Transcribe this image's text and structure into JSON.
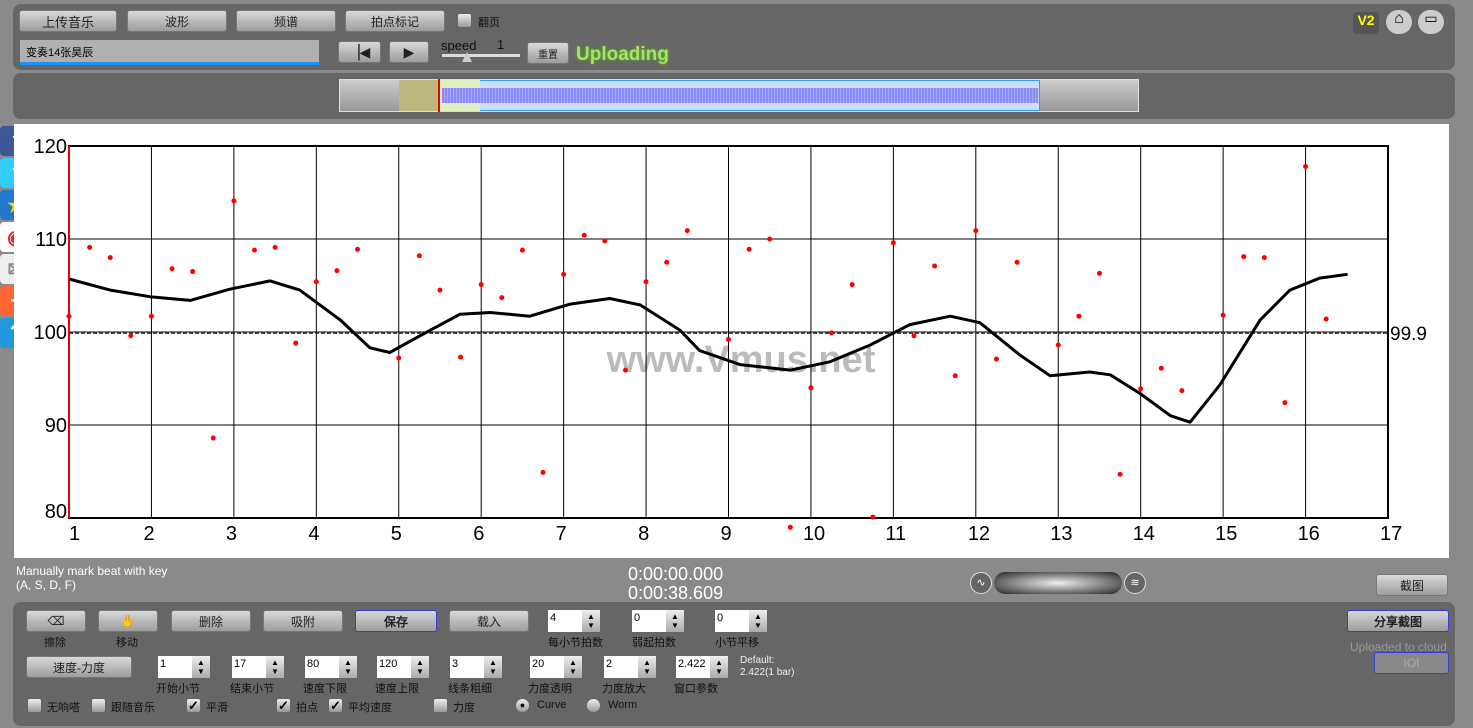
{
  "toolbar": {
    "upload": "上传音乐",
    "waveform": "波形",
    "spectrum": "频谱",
    "beat_mark": "拍点标记",
    "page_turn": "翻页",
    "filename": "变奏14张昊辰",
    "speed_label": "speed",
    "speed_value": "1",
    "reset": "重置",
    "status": "Uploading",
    "icons": [
      "skip-back-icon",
      "play-icon",
      "v2-icon",
      "home-icon",
      "screen-icon"
    ]
  },
  "share": [
    "facebook-icon",
    "twitter-icon",
    "star-icon",
    "weibo-icon",
    "mail-icon",
    "plus-icon",
    "help-icon"
  ],
  "watermark": "www.Vmus.net",
  "hint": {
    "line1": "Manually mark beat with key",
    "line2": "(A, S, D, F)"
  },
  "time": {
    "current": "0:00:00.000",
    "total": "0:00:38.609"
  },
  "screenshot": "截图",
  "controls": {
    "erase": "擦除",
    "move": "移动",
    "delete": "删除",
    "snap": "吸附",
    "save": "保存",
    "load": "载入",
    "tempo_dynamics": "速度-力度",
    "share_shot": "分享截图",
    "uploaded": "Uploaded to cloud",
    "ioi": "IOI",
    "default1": "Default:",
    "default2": "2.422(1 bar)",
    "spinners": [
      {
        "label": "每小节拍数",
        "value": "4"
      },
      {
        "label": "弱起拍数",
        "value": "0"
      },
      {
        "label": "小节平移",
        "value": "0"
      },
      {
        "label": "开始小节",
        "value": "1"
      },
      {
        "label": "结束小节",
        "value": "17"
      },
      {
        "label": "速度下限",
        "value": "80"
      },
      {
        "label": "速度上限",
        "value": "120"
      },
      {
        "label": "线条粗细",
        "value": "3"
      },
      {
        "label": "力度透明",
        "value": "20"
      },
      {
        "label": "力度放大",
        "value": "2"
      },
      {
        "label": "窗口参数",
        "value": "2.422"
      }
    ],
    "checks": [
      {
        "label": "无响嗒",
        "checked": false
      },
      {
        "label": "跟随音乐",
        "checked": false
      },
      {
        "label": "平滑",
        "checked": true
      },
      {
        "label": "拍点",
        "checked": true
      },
      {
        "label": "平均速度",
        "checked": true
      },
      {
        "label": "力度",
        "checked": false
      }
    ],
    "radios": [
      {
        "label": "Curve",
        "checked": true
      },
      {
        "label": "Worm",
        "checked": false
      }
    ]
  },
  "chart_data": {
    "type": "scatter",
    "xlim": [
      1,
      17
    ],
    "ylim": [
      80,
      120
    ],
    "xticks": [
      "1",
      "2",
      "3",
      "4",
      "5",
      "6",
      "7",
      "8",
      "9",
      "10",
      "11",
      "12",
      "13",
      "14",
      "15",
      "16",
      "17"
    ],
    "yticks": [
      "80",
      "90",
      "100",
      "110",
      "120"
    ],
    "grid": true,
    "average": 99.9,
    "average_label": "99.9",
    "point_color": "#ff0000",
    "points": [
      [
        1,
        101.7
      ],
      [
        1.25,
        109.1
      ],
      [
        1.5,
        108.0
      ],
      [
        1.75,
        99.6
      ],
      [
        2,
        101.7
      ],
      [
        2.25,
        106.8
      ],
      [
        2.5,
        106.5
      ],
      [
        2.75,
        88.6
      ],
      [
        3,
        114.1
      ],
      [
        3.25,
        108.8
      ],
      [
        3.5,
        109.1
      ],
      [
        3.75,
        98.8
      ],
      [
        4,
        105.4
      ],
      [
        4.25,
        106.6
      ],
      [
        4.5,
        108.9
      ],
      [
        5,
        97.2
      ],
      [
        5.25,
        108.2
      ],
      [
        5.5,
        104.5
      ],
      [
        5.75,
        97.3
      ],
      [
        6,
        105.1
      ],
      [
        6.25,
        103.7
      ],
      [
        6.5,
        108.8
      ],
      [
        6.75,
        84.9
      ],
      [
        7,
        106.2
      ],
      [
        7.25,
        110.4
      ],
      [
        7.5,
        109.8
      ],
      [
        7.75,
        95.9
      ],
      [
        8,
        105.4
      ],
      [
        8.25,
        107.5
      ],
      [
        8.5,
        110.9
      ],
      [
        9,
        99.2
      ],
      [
        9.25,
        108.9
      ],
      [
        9.5,
        110.0
      ],
      [
        9.75,
        79.0
      ],
      [
        10,
        94.0
      ],
      [
        10.25,
        99.9
      ],
      [
        10.5,
        105.1
      ],
      [
        10.75,
        80.1
      ],
      [
        11,
        109.6
      ],
      [
        11.25,
        99.6
      ],
      [
        11.5,
        107.1
      ],
      [
        11.75,
        95.3
      ],
      [
        12,
        110.9
      ],
      [
        12.25,
        97.1
      ],
      [
        12.5,
        107.5
      ],
      [
        13,
        98.6
      ],
      [
        13.25,
        101.7
      ],
      [
        13.5,
        106.3
      ],
      [
        13.75,
        84.7
      ],
      [
        14,
        93.9
      ],
      [
        14.25,
        96.1
      ],
      [
        14.5,
        93.7
      ],
      [
        15,
        101.8
      ],
      [
        15.25,
        108.1
      ],
      [
        15.5,
        108.0
      ],
      [
        15.75,
        92.4
      ],
      [
        16,
        117.8
      ],
      [
        16.25,
        101.4
      ]
    ],
    "curve": [
      [
        1,
        105.7
      ],
      [
        1.5,
        104.5
      ],
      [
        1.98,
        103.8
      ],
      [
        2.47,
        103.4
      ],
      [
        2.95,
        104.6
      ],
      [
        3.44,
        105.5
      ],
      [
        3.8,
        104.5
      ],
      [
        4.29,
        101.3
      ],
      [
        4.65,
        98.3
      ],
      [
        4.89,
        97.8
      ],
      [
        5.26,
        99.6
      ],
      [
        5.74,
        101.9
      ],
      [
        6.11,
        102.1
      ],
      [
        6.59,
        101.7
      ],
      [
        7.08,
        103.0
      ],
      [
        7.56,
        103.6
      ],
      [
        7.93,
        102.9
      ],
      [
        8.41,
        100.2
      ],
      [
        8.65,
        98.0
      ],
      [
        9.14,
        96.5
      ],
      [
        9.75,
        95.9
      ],
      [
        10.23,
        96.8
      ],
      [
        10.72,
        98.6
      ],
      [
        11.2,
        100.8
      ],
      [
        11.69,
        101.7
      ],
      [
        12.05,
        101.0
      ],
      [
        12.54,
        97.5
      ],
      [
        12.9,
        95.3
      ],
      [
        13.38,
        95.7
      ],
      [
        13.63,
        95.4
      ],
      [
        13.99,
        93.4
      ],
      [
        14.36,
        91.0
      ],
      [
        14.6,
        90.3
      ],
      [
        14.96,
        94.3
      ],
      [
        15.45,
        101.3
      ],
      [
        15.81,
        104.5
      ],
      [
        16.17,
        105.8
      ],
      [
        16.51,
        106.2
      ]
    ]
  }
}
